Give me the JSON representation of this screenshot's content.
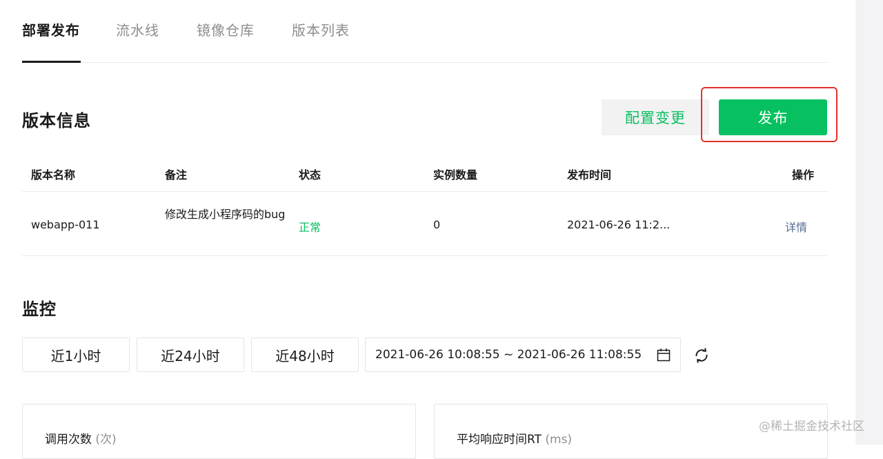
{
  "tabs": [
    {
      "label": "部署发布",
      "active": true
    },
    {
      "label": "流水线",
      "active": false
    },
    {
      "label": "镜像仓库",
      "active": false
    },
    {
      "label": "版本列表",
      "active": false
    }
  ],
  "version_section": {
    "title": "版本信息",
    "config_button": "配置变更",
    "publish_button": "发布"
  },
  "table": {
    "headers": [
      "版本名称",
      "备注",
      "状态",
      "实例数量",
      "发布时间",
      "操作"
    ],
    "rows": [
      {
        "name": "webapp-011",
        "note": "修改生成小程序码的bug",
        "status": "正常",
        "instances": "0",
        "publish_time": "2021-06-26 11:2...",
        "action": "详情"
      }
    ]
  },
  "monitor": {
    "title": "监控",
    "ranges": [
      "近1小时",
      "近24小时",
      "近48小时"
    ],
    "date_range": "2021-06-26 10:08:55 ~ 2021-06-26 11:08:55",
    "cards": [
      {
        "title": "调用次数",
        "unit": "(次)"
      },
      {
        "title": "平均响应时间RT",
        "unit": "(ms)"
      }
    ]
  },
  "colors": {
    "accent": "#07c160",
    "link": "#576b95",
    "highlight": "#e2312a"
  },
  "icons": [
    "calendar-icon",
    "refresh-icon"
  ],
  "watermark": "@稀土掘金技术社区"
}
